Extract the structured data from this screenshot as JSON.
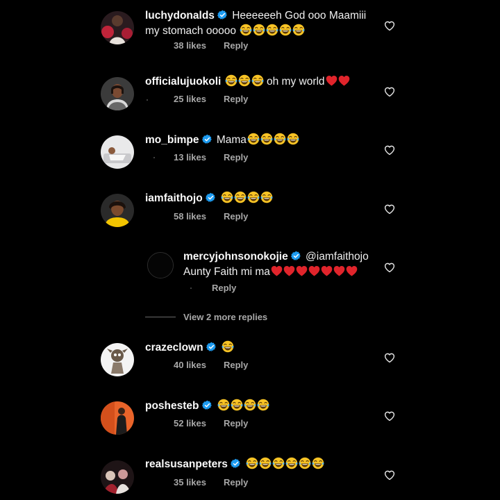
{
  "colors": {
    "background": "#000000",
    "verified": "#1d9bf0",
    "heart": "#e0242b",
    "muted": "#a8a8a8"
  },
  "comments": [
    {
      "username": "luchydonalds",
      "verified": true,
      "text": "Heeeeeeh God ooo Maamiii my stomach ooooo",
      "emojis": [
        "laughing-emoji",
        "laughing-emoji",
        "laughing-emoji",
        "laughing-emoji",
        "laughing-emoji"
      ],
      "likes": "38 likes",
      "reply": "Reply"
    },
    {
      "username": "officialujuokoli",
      "verified": false,
      "text_after_emojis": "oh my world",
      "emojis": [
        "laughing-emoji",
        "laughing-emoji",
        "laughing-emoji"
      ],
      "hearts": [
        "red-heart-emoji",
        "red-heart-emoji"
      ],
      "likes": "25 likes",
      "reply": "Reply"
    },
    {
      "username": "mo_bimpe",
      "verified": true,
      "text": "Mama",
      "emojis": [
        "laughing-emoji",
        "laughing-emoji",
        "laughing-emoji",
        "laughing-emoji"
      ],
      "likes": "13 likes",
      "reply": "Reply"
    },
    {
      "username": "iamfaithojo",
      "verified": true,
      "emojis": [
        "laughing-emoji",
        "laughing-emoji",
        "laughing-emoji",
        "laughing-emoji"
      ],
      "likes": "58 likes",
      "reply": "Reply"
    },
    {
      "username": "mercyjohnsonokojie",
      "verified": true,
      "mention": "@iamfaithojo",
      "text": "Aunty Faith mi ma",
      "hearts": [
        "red-heart-emoji",
        "red-heart-emoji",
        "red-heart-emoji",
        "red-heart-emoji",
        "red-heart-emoji",
        "red-heart-emoji",
        "red-heart-emoji"
      ],
      "reply": "Reply"
    },
    {
      "username": "crazeclown",
      "verified": true,
      "emojis": [
        "laughing-emoji"
      ],
      "likes": "40 likes",
      "reply": "Reply"
    },
    {
      "username": "poshesteb",
      "verified": true,
      "emojis": [
        "laughing-emoji",
        "laughing-emoji",
        "laughing-emoji",
        "laughing-emoji"
      ],
      "likes": "52 likes",
      "reply": "Reply"
    },
    {
      "username": "realsusanpeters",
      "verified": true,
      "emojis": [
        "laughing-emoji",
        "laughing-emoji",
        "laughing-emoji",
        "laughing-emoji",
        "laughing-emoji",
        "laughing-emoji"
      ],
      "likes": "35 likes",
      "reply": "Reply"
    }
  ],
  "view_more": "View 2 more replies",
  "icons": {
    "like": "heart-outline-icon",
    "verified": "verified-badge-icon"
  }
}
